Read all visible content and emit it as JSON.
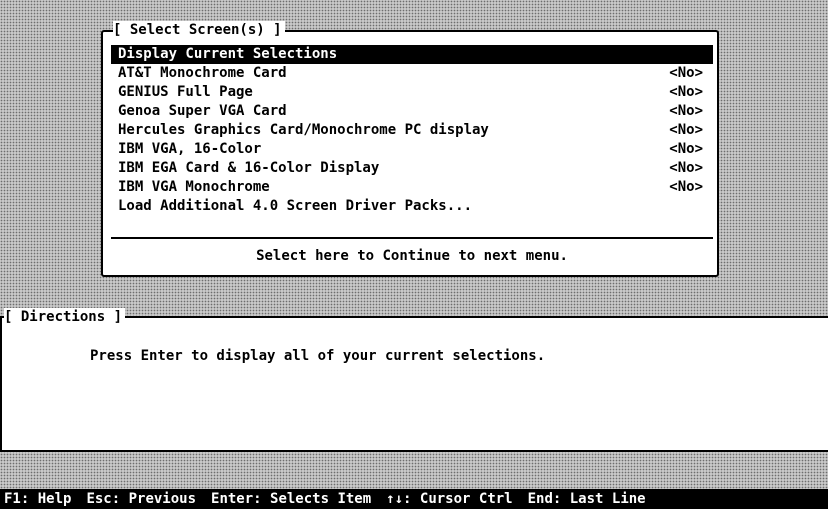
{
  "select_dialog": {
    "title": "[ Select Screen(s) ]",
    "items": [
      {
        "label": "Display Current Selections",
        "value": ""
      },
      {
        "label": "AT&T Monochrome Card",
        "value": "<No>"
      },
      {
        "label": "GENIUS Full Page",
        "value": "<No>"
      },
      {
        "label": "Genoa Super VGA Card",
        "value": "<No>"
      },
      {
        "label": "Hercules Graphics Card/Monochrome PC display",
        "value": "<No>"
      },
      {
        "label": "IBM VGA, 16-Color",
        "value": "<No>"
      },
      {
        "label": "IBM EGA Card & 16-Color Display",
        "value": "<No>"
      },
      {
        "label": "IBM VGA Monochrome",
        "value": "<No>"
      },
      {
        "label": "Load Additional 4.0 Screen Driver Packs...",
        "value": ""
      }
    ],
    "continue_label": "Select here to Continue to next menu."
  },
  "directions": {
    "title": "[ Directions ]",
    "text": "Press Enter to display all of your current selections."
  },
  "status_bar": {
    "keys": [
      "F1: Help",
      "Esc: Previous",
      "Enter: Selects Item",
      "↑↓: Cursor Ctrl",
      "End: Last Line"
    ]
  }
}
